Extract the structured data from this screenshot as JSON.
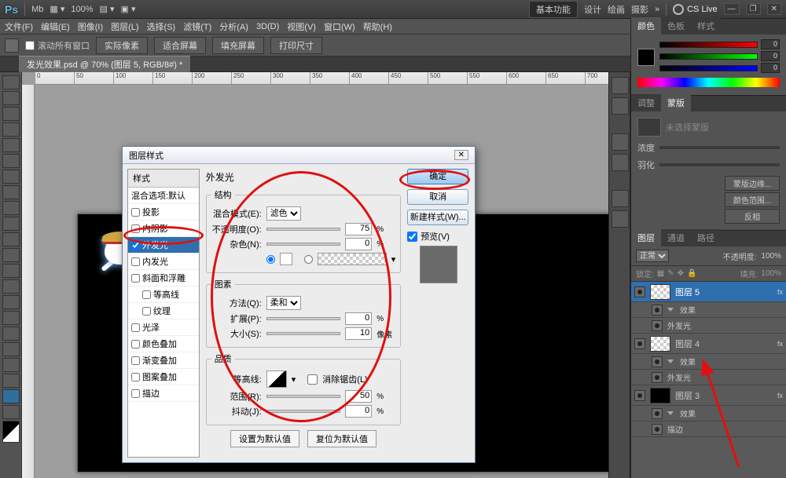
{
  "app": {
    "ps": "Ps",
    "zoom": "100%",
    "basic": "基本功能",
    "design": "设计",
    "draw": "绘画",
    "photo": "摄影",
    "cslive": "CS Live"
  },
  "winctrl": {
    "min": "—",
    "max": "❐",
    "close": "✕"
  },
  "menu": {
    "file": "文件(F)",
    "edit": "编辑(E)",
    "image": "图像(I)",
    "layer": "图层(L)",
    "select": "选择(S)",
    "filter": "滤镜(T)",
    "analysis": "分析(A)",
    "d3": "3D(D)",
    "view": "视图(V)",
    "window": "窗口(W)",
    "help": "帮助(H)"
  },
  "opts": {
    "scroll": "滚动所有窗口",
    "actual": "实际像素",
    "fit": "适合屏幕",
    "fill": "填充屏幕",
    "print": "打印尺寸"
  },
  "doc": {
    "tab": "发光效果.psd @ 70% (图层 5, RGB/8#) *"
  },
  "colorPanel": {
    "tab1": "颜色",
    "tab2": "色板",
    "tab3": "样式",
    "r": "0",
    "g": "0",
    "b": "0"
  },
  "maskPanel": {
    "tab1": "调整",
    "tab2": "蒙版",
    "none": "未选择蒙版",
    "density": "浓度",
    "feather": "羽化",
    "edge": "蒙版边缘...",
    "colorRange": "颜色范围...",
    "invert": "反相"
  },
  "layersPanel": {
    "tab1": "图层",
    "tab2": "通道",
    "tab3": "路径",
    "blend": "正常",
    "opacityLbl": "不透明度:",
    "opacity": "100%",
    "lockLbl": "锁定:",
    "fillLbl": "填充:",
    "fill": "100%",
    "l5": "图层 5",
    "l4": "图层 4",
    "l3": "图层 3",
    "fx": "fx",
    "effects": "效果",
    "outerGlow": "外发光",
    "stroke": "描边"
  },
  "dlg": {
    "title": "图层样式",
    "close": "✕",
    "left": {
      "hdr": "样式",
      "blending": "混合选项:默认",
      "dropShadow": "投影",
      "innerShadow": "内阴影",
      "outerGlow": "外发光",
      "innerGlow": "内发光",
      "bevel": "斜面和浮雕",
      "contour": "等高线",
      "texture": "纹理",
      "satin": "光泽",
      "colorOverlay": "颜色叠加",
      "gradOverlay": "渐变叠加",
      "patOverlay": "图案叠加",
      "stroke": "描边"
    },
    "right": {
      "ok": "确定",
      "cancel": "取消",
      "newStyle": "新建样式(W)...",
      "preview": "预览(V)"
    },
    "mid": {
      "h": "外发光",
      "struct": "结构",
      "blendMode": "混合模式(E):",
      "blendVal": "滤色",
      "opacity": "不透明度(O):",
      "opVal": "75",
      "noise": "杂色(N):",
      "noiseVal": "0",
      "pct": "%",
      "elements": "图素",
      "technique": "方法(Q):",
      "techVal": "柔和",
      "spread": "扩展(P):",
      "spreadVal": "0",
      "size": "大小(S):",
      "sizeVal": "10",
      "px": "像素",
      "quality": "品质",
      "contour": "等高线:",
      "antiAlias": "消除锯齿(L)",
      "range": "范围(R):",
      "rangeVal": "50",
      "jitter": "抖动(J):",
      "jitterVal": "0",
      "setDefault": "设置为默认值",
      "resetDefault": "复位为默认值"
    }
  }
}
